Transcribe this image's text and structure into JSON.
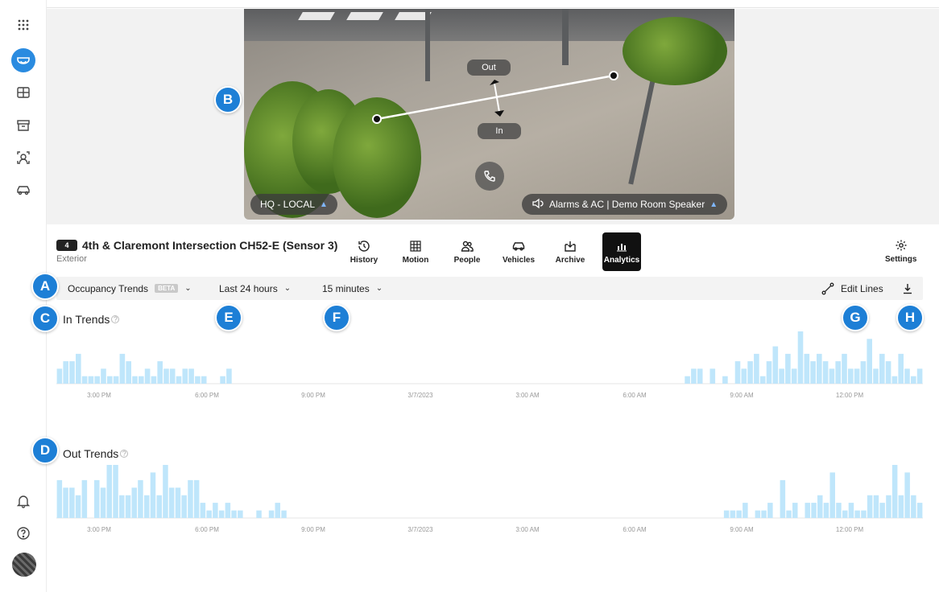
{
  "sidebar": {
    "items": [
      "grid-menu-icon",
      "camera-icon",
      "layout-icon",
      "archive-icon",
      "face-icon",
      "vehicle-icon"
    ],
    "bottom": [
      "bell-icon",
      "help-icon",
      "avatar"
    ]
  },
  "camera_view": {
    "site_label": "HQ - LOCAL",
    "speaker_label": "Alarms & AC | Demo Room Speaker",
    "out_label": "Out",
    "in_label": "In"
  },
  "badges": [
    "A",
    "B",
    "C",
    "D",
    "E",
    "F",
    "G",
    "H"
  ],
  "header": {
    "camera_count": "4",
    "title": "4th & Claremont Intersection CH52-E (Sensor 3)",
    "subtitle": "Exterior"
  },
  "tabs": [
    {
      "label": "History",
      "icon": "history-icon"
    },
    {
      "label": "Motion",
      "icon": "motion-grid-icon"
    },
    {
      "label": "People",
      "icon": "people-icon"
    },
    {
      "label": "Vehicles",
      "icon": "vehicle-icon"
    },
    {
      "label": "Archive",
      "icon": "archive-icon"
    },
    {
      "label": "Analytics",
      "icon": "analytics-icon",
      "active": true
    }
  ],
  "settings_label": "Settings",
  "toolbar": {
    "metric": "Occupancy Trends",
    "beta": "BETA",
    "range": "Last 24 hours",
    "interval": "15 minutes",
    "edit_lines": "Edit Lines"
  },
  "chart_data": [
    {
      "type": "bar",
      "title": "In Trends",
      "color": "#bfe6fb",
      "x_ticks": [
        "3:00 PM",
        "6:00 PM",
        "9:00 PM",
        "3/7/2023",
        "3:00 AM",
        "6:00 AM",
        "9:00 AM",
        "12:00 PM"
      ],
      "values": [
        2,
        3,
        3,
        4,
        1,
        1,
        1,
        2,
        1,
        1,
        4,
        3,
        1,
        1,
        2,
        1,
        3,
        2,
        2,
        1,
        2,
        2,
        1,
        1,
        0,
        0,
        1,
        2,
        0,
        0,
        0,
        0,
        0,
        0,
        0,
        0,
        0,
        0,
        0,
        0,
        0,
        0,
        0,
        0,
        0,
        0,
        0,
        0,
        0,
        0,
        0,
        0,
        0,
        0,
        0,
        0,
        0,
        0,
        0,
        0,
        0,
        0,
        0,
        0,
        0,
        0,
        0,
        0,
        0,
        0,
        0,
        0,
        0,
        0,
        0,
        0,
        0,
        0,
        0,
        0,
        0,
        0,
        0,
        0,
        0,
        0,
        0,
        0,
        0,
        0,
        0,
        0,
        0,
        0,
        0,
        0,
        0,
        0,
        0,
        0,
        1,
        2,
        2,
        0,
        2,
        0,
        1,
        0,
        3,
        2,
        3,
        4,
        1,
        3,
        5,
        2,
        4,
        2,
        7,
        4,
        3,
        4,
        3,
        2,
        3,
        4,
        2,
        2,
        3,
        6,
        2,
        4,
        3,
        1,
        4,
        2,
        1,
        2
      ]
    },
    {
      "type": "bar",
      "title": "Out Trends",
      "color": "#bfe6fb",
      "x_ticks": [
        "3:00 PM",
        "6:00 PM",
        "9:00 PM",
        "3/7/2023",
        "3:00 AM",
        "6:00 AM",
        "9:00 AM",
        "12:00 PM"
      ],
      "values": [
        5,
        4,
        4,
        3,
        5,
        0,
        5,
        4,
        7,
        7,
        3,
        3,
        4,
        5,
        3,
        6,
        3,
        7,
        4,
        4,
        3,
        5,
        5,
        2,
        1,
        2,
        1,
        2,
        1,
        1,
        0,
        0,
        1,
        0,
        1,
        2,
        1,
        0,
        0,
        0,
        0,
        0,
        0,
        0,
        0,
        0,
        0,
        0,
        0,
        0,
        0,
        0,
        0,
        0,
        0,
        0,
        0,
        0,
        0,
        0,
        0,
        0,
        0,
        0,
        0,
        0,
        0,
        0,
        0,
        0,
        0,
        0,
        0,
        0,
        0,
        0,
        0,
        0,
        0,
        0,
        0,
        0,
        0,
        0,
        0,
        0,
        0,
        0,
        0,
        0,
        0,
        0,
        0,
        0,
        0,
        0,
        0,
        0,
        0,
        0,
        0,
        0,
        0,
        0,
        0,
        0,
        0,
        1,
        1,
        1,
        2,
        0,
        1,
        1,
        2,
        0,
        5,
        1,
        2,
        0,
        2,
        2,
        3,
        2,
        6,
        2,
        1,
        2,
        1,
        1,
        3,
        3,
        2,
        3,
        7,
        3,
        6,
        3,
        2
      ]
    }
  ]
}
